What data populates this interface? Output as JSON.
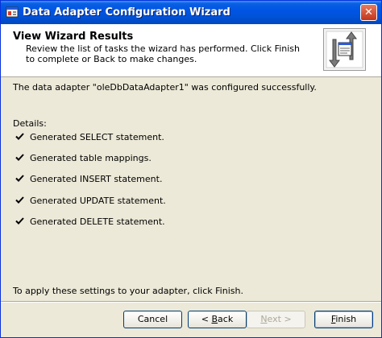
{
  "window": {
    "title": "Data Adapter Configuration Wizard",
    "close_label": "✕"
  },
  "header": {
    "title": "View Wizard Results",
    "description": "Review the list of tasks the wizard has performed. Click Finish to complete or Back to make changes."
  },
  "content": {
    "success_message": "The data adapter \"oleDbDataAdapter1\" was configured successfully.",
    "details_label": "Details:",
    "tasks": [
      {
        "label": "Generated SELECT statement."
      },
      {
        "label": "Generated table mappings."
      },
      {
        "label": "Generated INSERT statement."
      },
      {
        "label": "Generated UPDATE statement."
      },
      {
        "label": "Generated DELETE statement."
      }
    ],
    "footer_note": "To apply these settings to your adapter, click Finish."
  },
  "buttons": {
    "cancel": "Cancel",
    "back_prefix": "< ",
    "back_mnemonic": "B",
    "back_rest": "ack",
    "next_mnemonic": "N",
    "next_rest": "ext >",
    "finish_mnemonic": "F",
    "finish_rest": "inish"
  },
  "icons": {
    "app": "wizard-app-icon",
    "header": "data-adapter-arrows-icon",
    "task_check": "checkmark-icon"
  },
  "colors": {
    "title_bar": "#0055e5",
    "dialog_bg": "#ece9d8",
    "header_bg": "#ffffff",
    "close_button": "#c2351b"
  }
}
